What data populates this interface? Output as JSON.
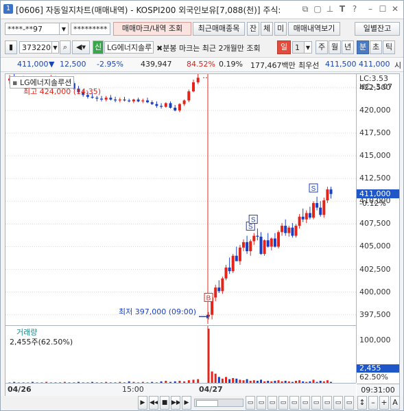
{
  "titlebar": {
    "num": "1",
    "title": "[0606] 자동일지차트(매매내역) - KOSPI200 외국인보유[7,088(천)] 주식:"
  },
  "toolbar1": {
    "account": "****-**97",
    "password": "*********",
    "mark_button": "매매마크/내역 조회",
    "recent_button": "최근매매종목",
    "btn_jan": "잔",
    "btn_che": "체",
    "btn_mi": "미",
    "history_button": "매매내역보기",
    "daily_button": "일별잔고"
  },
  "toolbar2": {
    "code": "373220",
    "sin": "신",
    "stock_name": "LG에너지솔루",
    "notice": "✖분봉 마크는 최근 2개월만 조회",
    "period": "일",
    "interval": "1",
    "tabs": [
      "주",
      "월",
      "년",
      "분",
      "초",
      "틱"
    ]
  },
  "quote": {
    "price": "411,000",
    "arrow": "▼",
    "change": "12,500",
    "pct": "-2.95%",
    "volume": "439,947",
    "vol_ratio": "84.52%",
    "turnover": "0.19%",
    "amount": "177,467백만",
    "best_label": "최우선",
    "ask": "411,500",
    "bid": "411,000",
    "more": "시"
  },
  "chart": {
    "legend_name": "LG에너지솔루션",
    "high_label": "최고 424,000 (14:35)",
    "low_label": "최저 397,000 (09:00)",
    "lc": "LC:3.53",
    "hc": "HC:-3.07",
    "price_ticks": [
      "422,500",
      "420,000",
      "417,500",
      "415,000",
      "412,500",
      "410,000",
      "407,500",
      "405,000",
      "402,500",
      "400,000",
      "397,500"
    ],
    "current_price": "411,000",
    "current_pct": "-0.12%",
    "volume_label": "거래량",
    "volume_value": "2,455주(62.50%)",
    "volume_tick": "100,000",
    "current_volume": "2,455",
    "current_volume_pct": "62.50%",
    "x_labels": [
      "04/26",
      "15:00",
      "04/27"
    ],
    "time": "09:31:00",
    "marks": {
      "buy": "B",
      "sell": "S"
    }
  },
  "chart_data": {
    "type": "candlestick",
    "ylim": [
      396500,
      424000
    ],
    "prior_day": [
      [
        423300,
        423900,
        422900,
        423500
      ],
      [
        423500,
        424000,
        423000,
        423100
      ],
      [
        423100,
        423600,
        422600,
        423300
      ],
      [
        423300,
        423800,
        422900,
        423000
      ],
      [
        423000,
        423400,
        422600,
        423200
      ],
      [
        423200,
        423700,
        422800,
        423000
      ],
      [
        423000,
        423500,
        422700,
        423200
      ],
      [
        423200,
        423600,
        422900,
        423100
      ],
      [
        423100,
        423600,
        422700,
        423300
      ],
      [
        423300,
        423900,
        423000,
        423500
      ],
      [
        423500,
        423800,
        423000,
        423100
      ],
      [
        423100,
        423500,
        422800,
        423000
      ],
      [
        423000,
        423300,
        422700,
        423100
      ],
      [
        423100,
        423400,
        422800,
        423000
      ],
      [
        423000,
        423200,
        422300,
        422400
      ],
      [
        422400,
        422700,
        421800,
        422000
      ],
      [
        422000,
        422300,
        421500,
        421700
      ],
      [
        421700,
        422100,
        421300,
        421500
      ],
      [
        421500,
        421900,
        421300,
        421400
      ],
      [
        421400,
        421600,
        421000,
        421300
      ],
      [
        421300,
        421600,
        421000,
        421200
      ],
      [
        421200,
        421600,
        421000,
        421400
      ],
      [
        421400,
        421700,
        421100,
        421200
      ],
      [
        421200,
        421500,
        420900,
        421100
      ],
      [
        421100,
        421400,
        420900,
        421200
      ],
      [
        421200,
        421500,
        421000,
        421100
      ],
      [
        421100,
        421300,
        420900,
        421000
      ],
      [
        421000,
        421300,
        420800,
        421200
      ],
      [
        421200,
        421400,
        420900,
        421000
      ],
      [
        421000,
        421300,
        420800,
        421100
      ],
      [
        421100,
        421400,
        420800,
        420900
      ],
      [
        420900,
        421100,
        420600,
        420700
      ],
      [
        420700,
        421000,
        420300,
        420500
      ],
      [
        420500,
        420800,
        420200,
        420400
      ],
      [
        420400,
        420900,
        420300,
        420800
      ],
      [
        420800,
        421000,
        420200,
        420300
      ],
      [
        420300,
        420600,
        419900,
        420000
      ],
      [
        420000,
        420800,
        419800,
        420700
      ],
      [
        420700,
        421200,
        420500,
        421100
      ],
      [
        421100,
        422300,
        420900,
        422100
      ],
      [
        422100,
        423400,
        422000,
        423100
      ],
      [
        423100,
        424000,
        422900,
        423600
      ]
    ],
    "today": [
      [
        397300,
        397800,
        397000,
        397500
      ],
      [
        397500,
        399500,
        397000,
        399400
      ],
      [
        399400,
        400800,
        399000,
        400500
      ],
      [
        400500,
        401300,
        399900,
        400100
      ],
      [
        400100,
        401700,
        399800,
        401500
      ],
      [
        401500,
        403000,
        401300,
        402700
      ],
      [
        402700,
        403800,
        402000,
        402300
      ],
      [
        402300,
        404200,
        402100,
        404000
      ],
      [
        404000,
        405000,
        403500,
        403400
      ],
      [
        403400,
        405200,
        403000,
        404900
      ],
      [
        404900,
        405800,
        404500,
        405500
      ],
      [
        405500,
        406200,
        404200,
        404500
      ],
      [
        404500,
        405800,
        404000,
        405600
      ],
      [
        405600,
        406500,
        405200,
        406200
      ],
      [
        406200,
        407000,
        405700,
        406100
      ],
      [
        406100,
        406600,
        404100,
        404200
      ],
      [
        404200,
        405800,
        404000,
        405700
      ],
      [
        405700,
        406500,
        404900,
        405000
      ],
      [
        405000,
        406000,
        404600,
        405900
      ],
      [
        405900,
        406500,
        404900,
        405000
      ],
      [
        405000,
        406800,
        404800,
        406600
      ],
      [
        406600,
        407600,
        406200,
        407300
      ],
      [
        407300,
        408000,
        406200,
        406500
      ],
      [
        406500,
        407300,
        406100,
        407100
      ],
      [
        407100,
        407600,
        406000,
        406200
      ],
      [
        406200,
        407500,
        406000,
        407300
      ],
      [
        407300,
        408600,
        407000,
        408300
      ],
      [
        408300,
        409200,
        407700,
        408000
      ],
      [
        408000,
        409000,
        407600,
        408700
      ],
      [
        408700,
        409400,
        408000,
        408200
      ],
      [
        408200,
        410000,
        408000,
        409800
      ],
      [
        409800,
        410500,
        409000,
        409300
      ],
      [
        409300,
        410000,
        408300,
        408500
      ],
      [
        408500,
        410400,
        408200,
        410100
      ],
      [
        410100,
        411600,
        409800,
        411300
      ],
      [
        411300,
        411600,
        410300,
        410800
      ]
    ],
    "prior_volume": [
      2,
      3,
      2,
      2,
      2,
      3,
      2,
      2,
      3,
      2,
      2,
      2,
      3,
      2,
      2,
      3,
      2,
      2,
      3,
      2,
      2,
      3,
      2,
      2,
      3,
      2,
      4,
      3,
      2,
      3,
      2,
      3,
      2,
      4,
      5,
      3,
      4,
      5,
      4,
      6,
      7,
      8
    ],
    "today_volume": [
      100,
      22,
      18,
      12,
      9,
      12,
      8,
      10,
      9,
      7,
      6,
      8,
      5,
      6,
      5,
      7,
      4,
      5,
      4,
      5,
      6,
      4,
      5,
      4,
      3,
      5,
      6,
      4,
      3,
      4,
      7,
      3,
      5,
      4,
      6,
      3
    ],
    "colors": {
      "up": "#e3241b",
      "down": "#1a3fc6",
      "grid": "#d8d8d8"
    }
  }
}
